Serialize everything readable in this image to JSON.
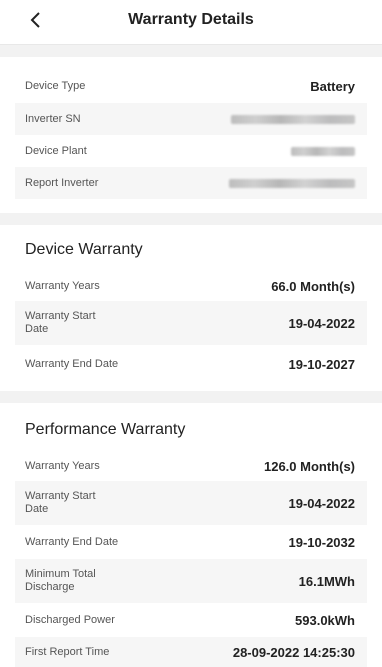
{
  "header": {
    "title": "Warranty Details"
  },
  "device": {
    "rows": [
      {
        "label": "Device Type",
        "value": "Battery"
      },
      {
        "label": "Inverter SN"
      },
      {
        "label": "Device Plant"
      },
      {
        "label": "Report Inverter"
      }
    ]
  },
  "device_warranty": {
    "title": "Device Warranty",
    "rows": [
      {
        "label": "Warranty Years",
        "value": "66.0 Month(s)"
      },
      {
        "label": "Warranty Start Date",
        "value": "19-04-2022"
      },
      {
        "label": "Warranty End Date",
        "value": "19-10-2027"
      }
    ]
  },
  "performance_warranty": {
    "title": "Performance Warranty",
    "rows": [
      {
        "label": "Warranty Years",
        "value": "126.0 Month(s)"
      },
      {
        "label": "Warranty Start Date",
        "value": "19-04-2022"
      },
      {
        "label": "Warranty End Date",
        "value": "19-10-2032"
      },
      {
        "label": "Minimum Total Discharge",
        "value": "16.1MWh"
      },
      {
        "label": "Discharged Power",
        "value": "593.0kWh"
      },
      {
        "label": "First Report Time",
        "value": "28-09-2022 14:25:30"
      }
    ]
  }
}
